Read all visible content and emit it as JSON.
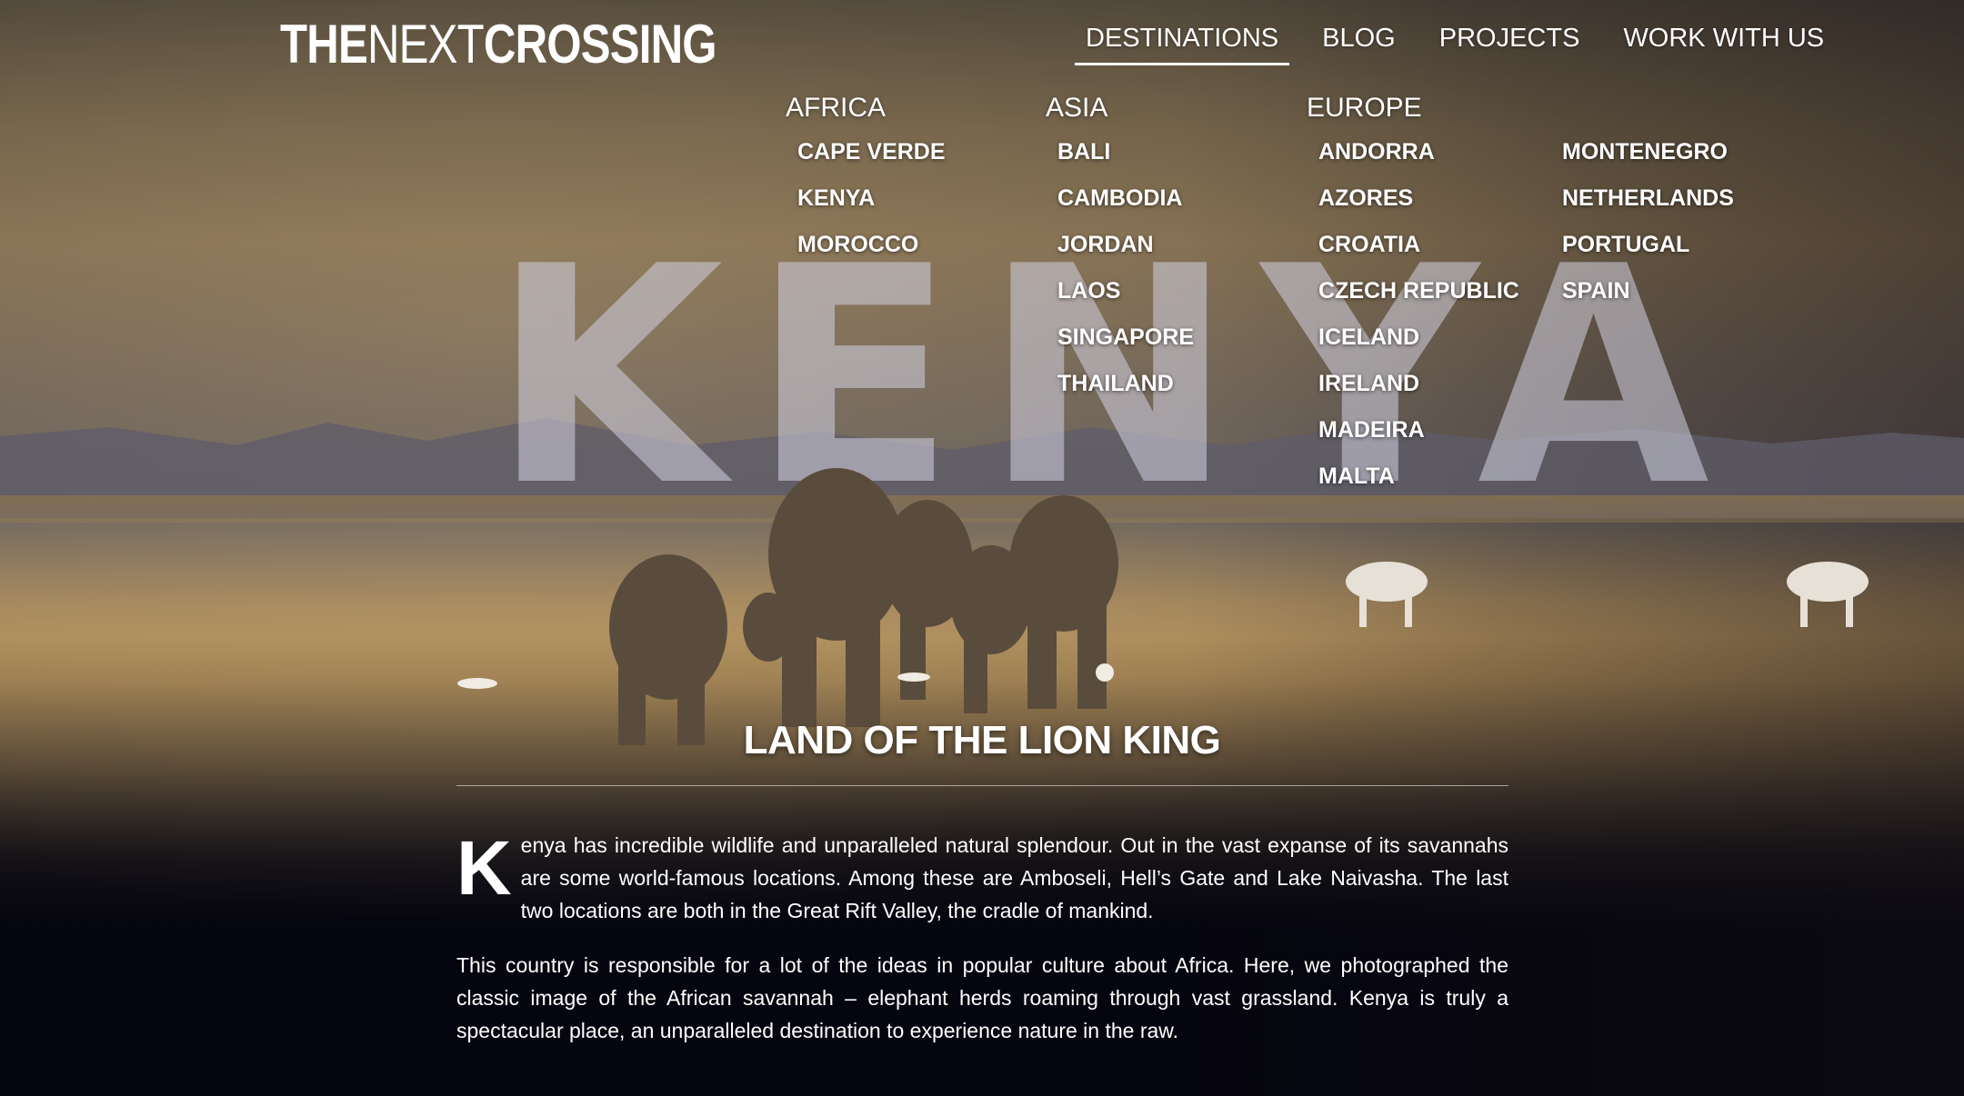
{
  "site": {
    "logo_bold_1": "THE",
    "logo_light": "NEXT",
    "logo_bold_2": "CROSSING"
  },
  "nav": {
    "items": [
      {
        "label": "DESTINATIONS",
        "active": true
      },
      {
        "label": "BLOG",
        "active": false
      },
      {
        "label": "PROJECTS",
        "active": false
      },
      {
        "label": "WORK WITH US",
        "active": false
      }
    ]
  },
  "menu": {
    "africa": {
      "title": "AFRICA",
      "items": [
        "CAPE VERDE",
        "KENYA",
        "MOROCCO"
      ]
    },
    "asia": {
      "title": "ASIA",
      "items": [
        "BALI",
        "CAMBODIA",
        "JORDAN",
        "LAOS",
        "SINGAPORE",
        "THAILAND"
      ]
    },
    "europe": {
      "title": "EUROPE",
      "items": [
        "ANDORRA",
        "AZORES",
        "CROATIA",
        "CZECH REPUBLIC",
        "ICELAND",
        "IRELAND",
        "MADEIRA",
        "MALTA"
      ],
      "items2": [
        "MONTENEGRO",
        "NETHERLANDS",
        "PORTUGAL",
        "SPAIN"
      ]
    }
  },
  "hero": {
    "watermark": "KENYA",
    "headline": "LAND OF THE LION KING"
  },
  "article": {
    "dropcap": "K",
    "para1": "enya has incredible wildlife and unparalleled natural splendour. Out in the vast expanse of its savannahs are some world-famous locations. Among these are Amboseli, Hell’s Gate and Lake Naivasha. The last two locations are both in the Great Rift Valley, the cradle of mankind.",
    "para2": "This country is responsible for a lot of the ideas in popular culture about Africa. Here, we photographed the classic image of the African savannah – elephant herds roaming through vast grassland. Kenya is truly a spectacular place, an unparalleled destination to experience nature in the raw."
  },
  "colors": {
    "background": "#05050f",
    "text": "#ffffff",
    "savannah": "#b8945c"
  }
}
